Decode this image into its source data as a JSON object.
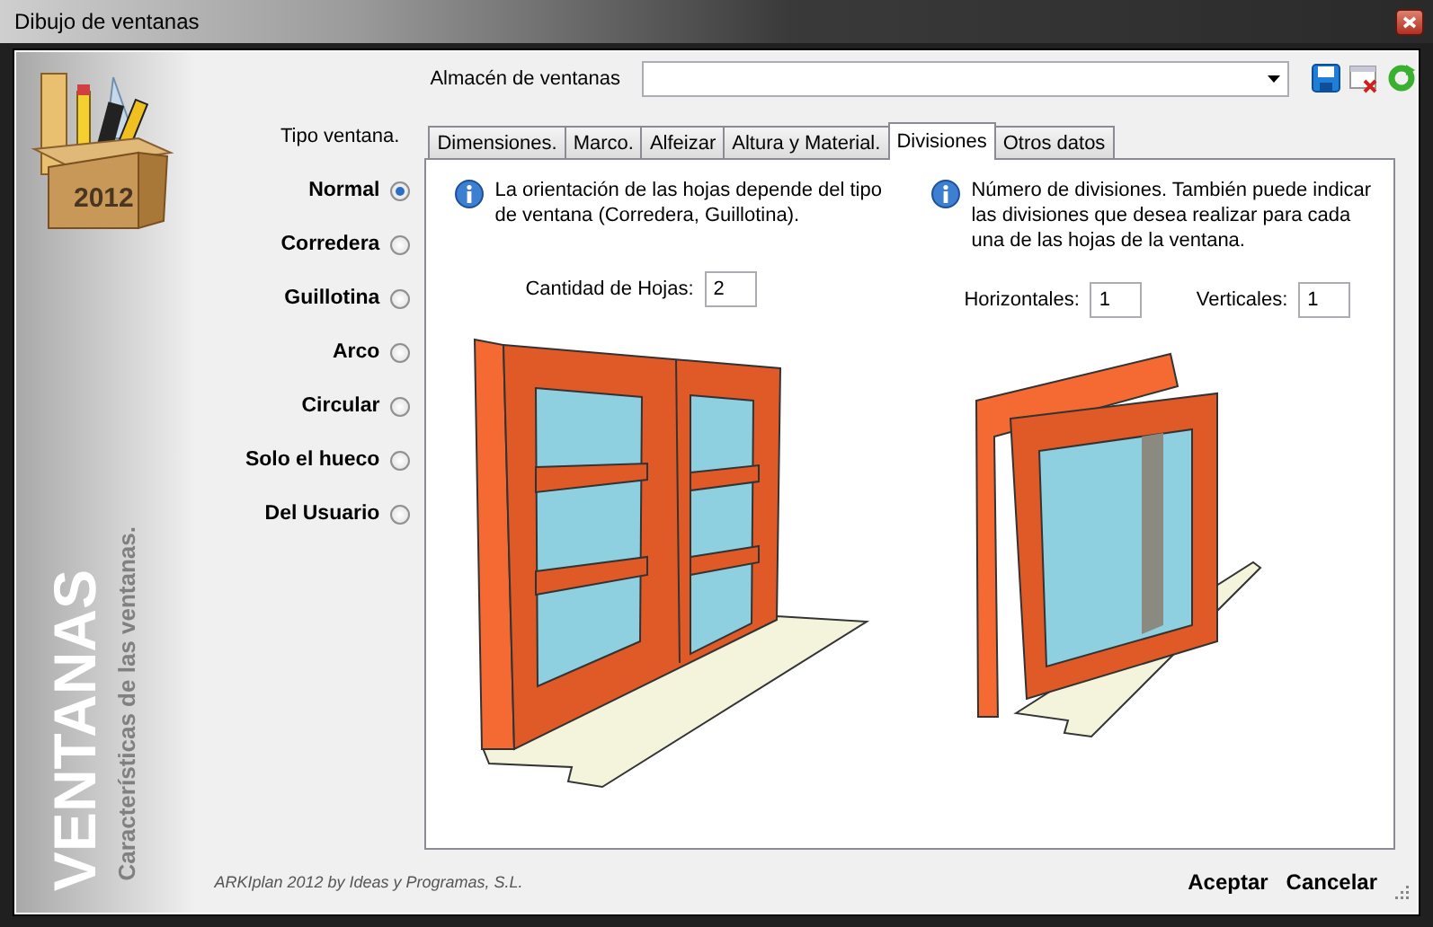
{
  "window": {
    "title": "Dibujo de ventanas"
  },
  "sidebar": {
    "badge": "2012",
    "title": "VENTANAS",
    "subtitle": "Características de las ventanas."
  },
  "store": {
    "label": "Almacén de ventanas"
  },
  "window_type": {
    "label": "Tipo ventana.",
    "options": [
      {
        "label": "Normal",
        "selected": true
      },
      {
        "label": "Corredera",
        "selected": false
      },
      {
        "label": "Guillotina",
        "selected": false
      },
      {
        "label": "Arco",
        "selected": false
      },
      {
        "label": "Circular",
        "selected": false
      },
      {
        "label": "Solo el hueco",
        "selected": false
      },
      {
        "label": "Del Usuario",
        "selected": false
      }
    ]
  },
  "tabs": [
    {
      "label": "Dimensiones.",
      "selected": false
    },
    {
      "label": "Marco.",
      "selected": false
    },
    {
      "label": "Alfeizar",
      "selected": false
    },
    {
      "label": "Altura y Material.",
      "selected": false
    },
    {
      "label": "Divisiones",
      "selected": true
    },
    {
      "label": "Otros datos",
      "selected": false
    }
  ],
  "panel": {
    "sheets": {
      "info": "La orientación de las hojas depende del tipo de ventana (Corredera, Guillotina).",
      "fields": [
        {
          "label": "Cantidad de Hojas:",
          "value": "2"
        }
      ]
    },
    "divisions": {
      "info": "Número de divisiones. También puede indicar las divisiones que desea realizar para cada una de las hojas de la ventana.",
      "fields": [
        {
          "label": "Horizontales:",
          "value": "1"
        },
        {
          "label": "Verticales:",
          "value": "1"
        }
      ]
    }
  },
  "footer": {
    "credit": "ARKIplan 2012 by Ideas y Programas, S.L.",
    "buttons": [
      "Aceptar",
      "Cancelar"
    ]
  }
}
